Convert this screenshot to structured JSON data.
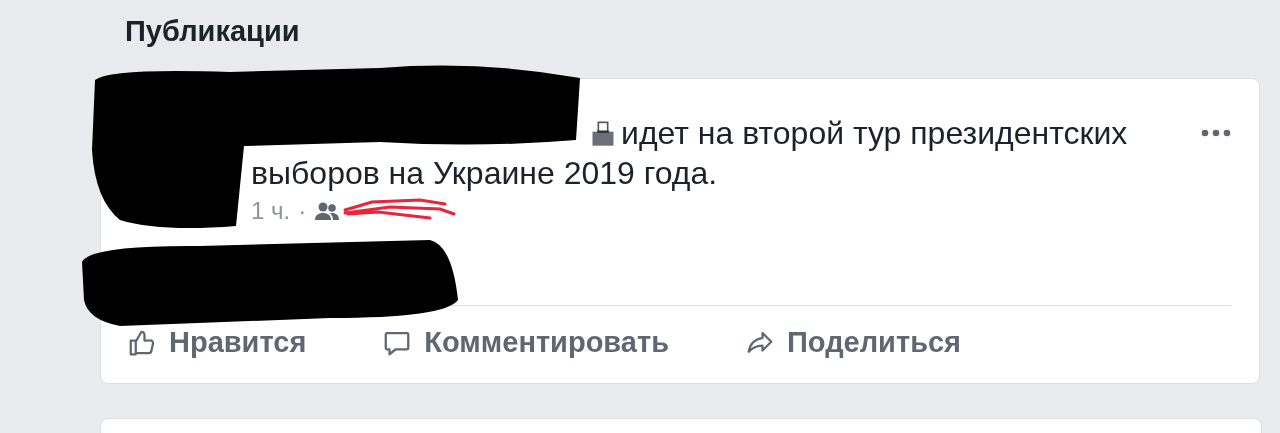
{
  "section_title": "Публикации",
  "post": {
    "text": "идет на второй тур президентских выборов на Украине 2019 года.",
    "time": "1 ч.",
    "separator": "·",
    "actions": [
      {
        "kind": "like",
        "label": "Нравится"
      },
      {
        "kind": "comment",
        "label": "Комментировать"
      },
      {
        "kind": "share",
        "label": "Поделиться"
      }
    ]
  }
}
